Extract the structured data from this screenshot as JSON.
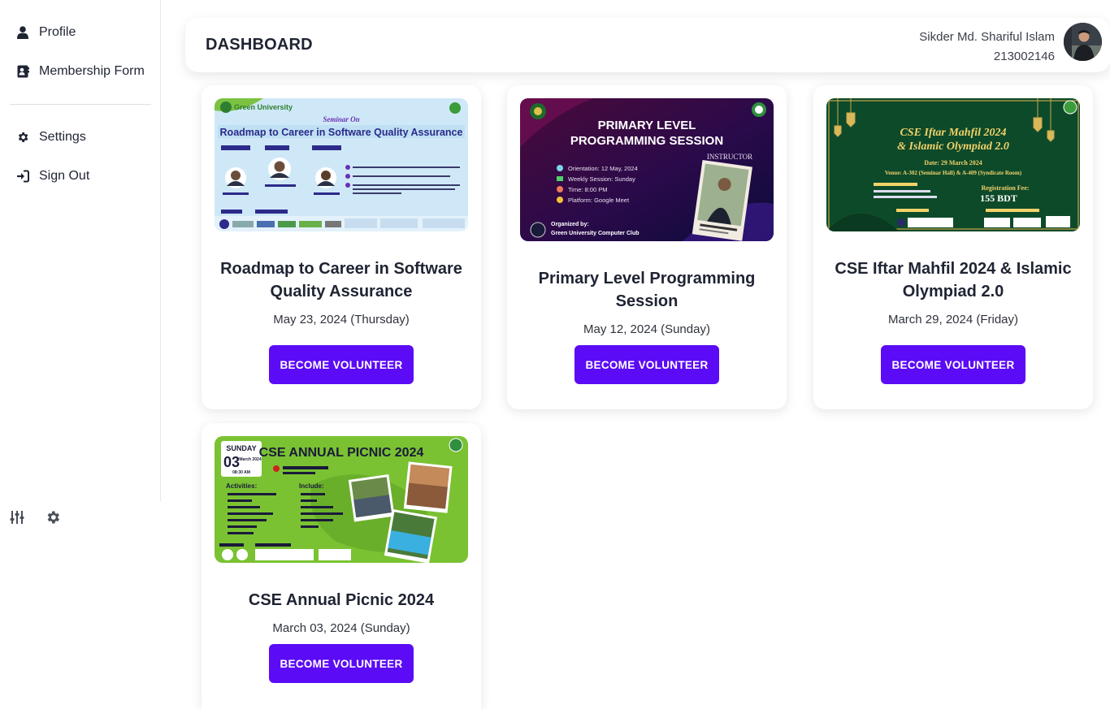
{
  "sidebar": {
    "items": [
      {
        "label": "Profile",
        "icon": "user-icon"
      },
      {
        "label": "Membership Form",
        "icon": "id-card-icon"
      },
      {
        "label": "Settings",
        "icon": "gear-icon"
      },
      {
        "label": "Sign Out",
        "icon": "sign-in-arrow-icon"
      }
    ],
    "bottom_icons": [
      "sliders-icon",
      "gear-icon"
    ]
  },
  "header": {
    "title": "DASHBOARD",
    "user_name": "Sikder Md. Shariful Islam",
    "user_id": "213002146"
  },
  "cards": [
    {
      "title": "Roadmap to Career in Software Quality Assurance",
      "date": "May 23, 2024 (Thursday)",
      "button": "BECOME VOLUNTEER",
      "poster": {
        "heading": "Roadmap to Career in Software Quality Assurance",
        "tag": "Seminar On",
        "brand": "Green University"
      }
    },
    {
      "title": "Primary Level Programming Session",
      "date": "May 12, 2024 (Sunday)",
      "button": "BECOME VOLUNTEER",
      "poster": {
        "heading1": "PRIMARY LEVEL",
        "heading2": "PROGRAMMING SESSION",
        "instructor": "INSTRUCTOR",
        "lines": [
          "Orientation: 12 May, 2024",
          "Weekly Session: Sunday",
          "Time: 8:00 PM",
          "Platform: Google Meet"
        ],
        "org1": "Organized by:",
        "org2": "Green University Computer Club"
      }
    },
    {
      "title": "CSE Iftar Mahfil 2024 & Islamic Olympiad 2.0",
      "date": "March 29, 2024 (Friday)",
      "button": "BECOME VOLUNTEER",
      "poster": {
        "heading1": "CSE Iftar Mahfil 2024",
        "heading2": "& Islamic Olympiad 2.0",
        "date": "Date: 29 March 2024",
        "venue": "Venue: A-302 (Seminar Hall) & A-409 (Syndicate Room)",
        "fee_label": "Registration Fee:",
        "fee": "155 BDT"
      }
    },
    {
      "title": "CSE Annual Picnic 2024",
      "date": "March 03, 2024 (Sunday)",
      "button": "BECOME VOLUNTEER",
      "poster": {
        "heading": "CSE ANNUAL PICNIC 2024",
        "day": "SUNDAY",
        "daynum": "03",
        "month": "March 2024",
        "time": "08:30 AM",
        "activities": "Activities:",
        "include": "Include:"
      }
    }
  ],
  "colors": {
    "accent": "#5b0bf5"
  }
}
